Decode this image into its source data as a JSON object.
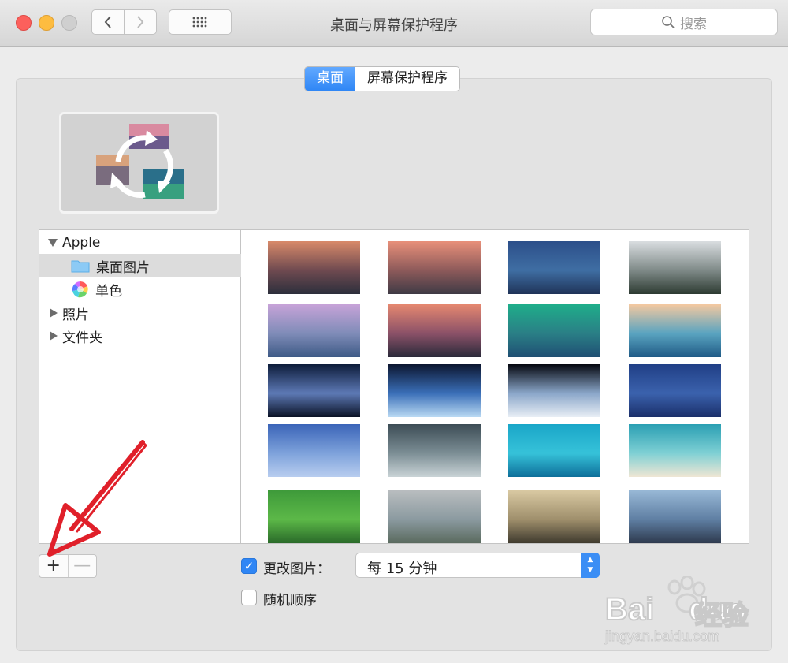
{
  "window": {
    "title": "桌面与屏幕保护程序"
  },
  "toolbar": {
    "back_glyph": "‹",
    "forward_glyph": "›",
    "grid_glyph": "⠿"
  },
  "search": {
    "placeholder": "搜索",
    "icon": "search-icon"
  },
  "tabs": [
    {
      "label": "桌面",
      "active": true
    },
    {
      "label": "屏幕保护程序",
      "active": false
    }
  ],
  "sidebar": {
    "items": [
      {
        "label": "Apple",
        "expanded": true,
        "level": 0
      },
      {
        "label": "桌面图片",
        "icon": "folder-icon",
        "selected": true,
        "level": 1
      },
      {
        "label": "单色",
        "icon": "color-wheel-icon",
        "level": 1
      },
      {
        "label": "照片",
        "expanded": false,
        "level": 0
      },
      {
        "label": "文件夹",
        "expanded": false,
        "level": 0
      }
    ]
  },
  "gallery": {
    "wallpapers": [
      {
        "name": "sierra-sunset-mountains",
        "colors": [
          "#d88a6a",
          "#6f4a50",
          "#2c2f3c"
        ]
      },
      {
        "name": "sierra-sunset-range",
        "colors": [
          "#e8907a",
          "#8d5a5a",
          "#3f3a45"
        ]
      },
      {
        "name": "blue-mountains-dusk",
        "colors": [
          "#2c4f8a",
          "#3f6ea3",
          "#1f3358"
        ]
      },
      {
        "name": "foggy-forest-cliff",
        "colors": [
          "#d9dde0",
          "#7f8a88",
          "#2d3b32"
        ]
      },
      {
        "name": "yosemite-half-dome-pink",
        "colors": [
          "#c7a3d8",
          "#7f8cb8",
          "#3e5a86"
        ]
      },
      {
        "name": "rocky-lake-sunset",
        "colors": [
          "#e58870",
          "#8b5168",
          "#2a2a3a"
        ]
      },
      {
        "name": "green-wave",
        "colors": [
          "#1fae8a",
          "#2a7f86",
          "#1f4f73"
        ]
      },
      {
        "name": "ocean-wave-blue",
        "colors": [
          "#f4c9a0",
          "#5aa4c0",
          "#1f5a86"
        ]
      },
      {
        "name": "galaxy-spiral",
        "colors": [
          "#0d1c3a",
          "#5d79b5",
          "#0a1226"
        ]
      },
      {
        "name": "earth-horizon-moon",
        "colors": [
          "#0c1630",
          "#3a6fb8",
          "#b9d9f3"
        ]
      },
      {
        "name": "earth-from-space",
        "colors": [
          "#05070f",
          "#8aa6c9",
          "#e8eef5"
        ]
      },
      {
        "name": "milky-way-blue",
        "colors": [
          "#203f86",
          "#3b62ad",
          "#1a2f6a"
        ]
      },
      {
        "name": "sky-crescent-moon",
        "colors": [
          "#3a64b8",
          "#7ea2db",
          "#b8cdef"
        ]
      },
      {
        "name": "storm-clouds",
        "colors": [
          "#3c4c55",
          "#7c8e95",
          "#c9d3d6"
        ]
      },
      {
        "name": "turquoise-water",
        "colors": [
          "#1aa6c8",
          "#36c2d9",
          "#0e6f9a"
        ]
      },
      {
        "name": "beach-shore",
        "colors": [
          "#2a9fb3",
          "#7fd0d4",
          "#efe6d4"
        ]
      },
      {
        "name": "green-terraces",
        "colors": [
          "#3e9a3a",
          "#5cb848",
          "#2a6a2a"
        ]
      },
      {
        "name": "autumn-fog-valley",
        "colors": [
          "#b9bdbf",
          "#8b9aa0",
          "#5a6a5e"
        ]
      },
      {
        "name": "forest-sunrays",
        "colors": [
          "#d9c9a2",
          "#9f8f6c",
          "#3f3a2e"
        ]
      },
      {
        "name": "misty-mountain-layers",
        "colors": [
          "#98b8d6",
          "#5f7fa3",
          "#2e3a4e"
        ]
      }
    ]
  },
  "controls": {
    "add_glyph": "+",
    "remove_glyph": "—",
    "change_picture_label": "更改图片：",
    "change_picture_checked": true,
    "interval_value": "每 15 分钟",
    "random_order_label": "随机顺序",
    "random_order_checked": false,
    "help_glyph": "?"
  },
  "watermark": {
    "brand": "Bai",
    "brand2": "du",
    "cn": "经验",
    "url": "jingyan.baidu.com"
  },
  "colors": {
    "accent": "#2f86f5",
    "annotation_arrow": "#e0202a"
  }
}
